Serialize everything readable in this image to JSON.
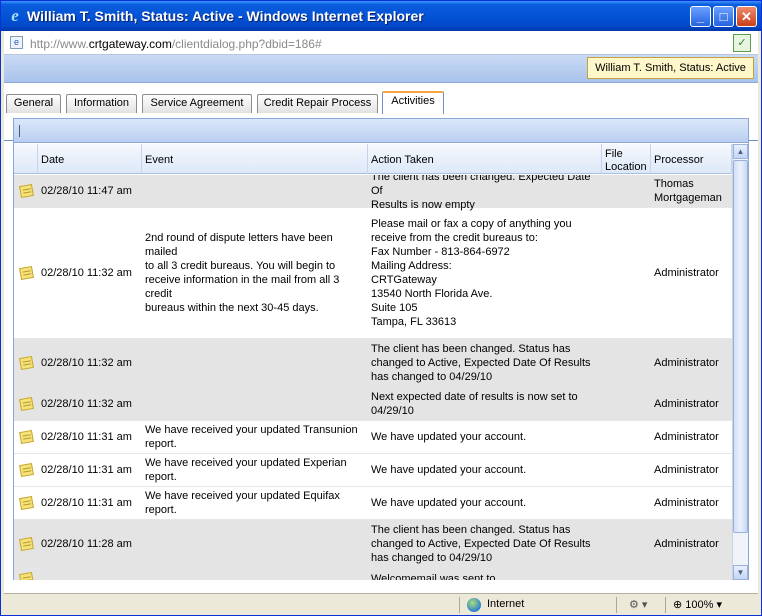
{
  "window": {
    "title": "William T. Smith, Status: Active - Windows Internet Explorer",
    "minimize": "_",
    "maximize": "□",
    "close": "✕"
  },
  "address": {
    "prefix": "http://www.",
    "domain": "crtgateway.com",
    "path": "/clientdialog.php?dbid=186#"
  },
  "status_badge": "William T. Smith, Status: Active",
  "tabs": [
    {
      "label": "General"
    },
    {
      "label": "Information"
    },
    {
      "label": "Service Agreement"
    },
    {
      "label": "Credit Repair Process"
    },
    {
      "label": "Activities",
      "active": true
    }
  ],
  "grid": {
    "columns": {
      "date": "Date",
      "event": "Event",
      "action": "Action Taken",
      "file_location": "File\nLocation",
      "processor": "Processor"
    },
    "rows": [
      {
        "date": "02/28/10 11:47 am",
        "event": "",
        "action": "The client has been changed. Expected Date Of\nResults is now empty",
        "processor": "Thomas\nMortgageman",
        "shaded": true
      },
      {
        "date": "02/28/10 11:32 am",
        "event": "2nd round of dispute letters have been mailed\nto all 3 credit bureaus. You will begin to\nreceive information in the mail from all 3 credit\nbureaus within the next 30-45 days.",
        "action": "Please mail or fax a copy of anything you\nreceive from the credit bureaus to:\nFax Number - 813-864-6972\nMailing Address:\nCRTGateway\n13540 North Florida Ave.\nSuite 105\nTampa, FL 33613",
        "processor": "Administrator",
        "shaded": false
      },
      {
        "date": "02/28/10 11:32 am",
        "event": "",
        "action": "The client has been changed. Status has\nchanged to Active, Expected Date Of Results\nhas changed to 04/29/10",
        "processor": "Administrator",
        "shaded": true
      },
      {
        "date": "02/28/10 11:32 am",
        "event": "",
        "action": "Next expected date of results is now set to\n04/29/10",
        "processor": "Administrator",
        "shaded": true
      },
      {
        "date": "02/28/10 11:31 am",
        "event": "We have received your updated Transunion\nreport.",
        "action": "We have updated your account.",
        "processor": "Administrator",
        "shaded": false
      },
      {
        "date": "02/28/10 11:31 am",
        "event": "We have received your updated Experian\nreport.",
        "action": "We have updated your account.",
        "processor": "Administrator",
        "shaded": false
      },
      {
        "date": "02/28/10 11:31 am",
        "event": "We have received your updated Equifax\nreport.",
        "action": "We have updated your account.",
        "processor": "Administrator",
        "shaded": false
      },
      {
        "date": "02/28/10 11:28 am",
        "event": "",
        "action": "The client has been changed. Status has\nchanged to Active, Expected Date Of Results\nhas changed to 04/29/10",
        "processor": "Administrator",
        "shaded": true
      },
      {
        "date": "",
        "event": "",
        "action": "Welcomemail was sent to",
        "processor": "",
        "shaded": true
      }
    ]
  },
  "statusbar": {
    "zone": "Internet",
    "zoom": "100%"
  }
}
